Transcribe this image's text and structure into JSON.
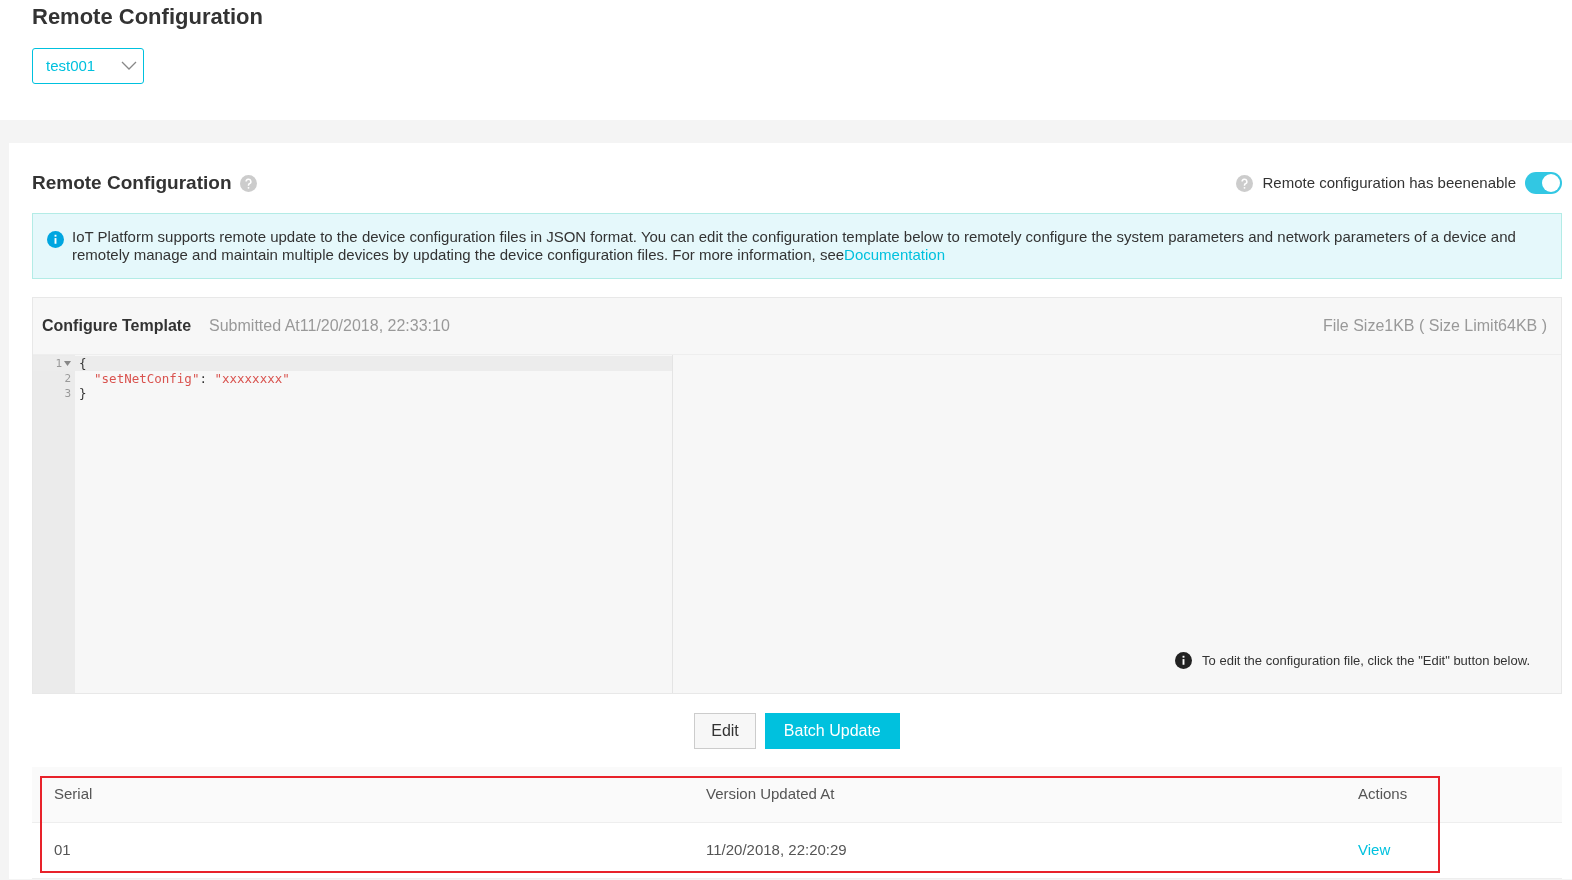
{
  "page_title": "Remote Configuration",
  "product_select": {
    "value": "test001"
  },
  "section": {
    "title": "Remote Configuration",
    "status_text": "Remote configuration has beenenable",
    "enabled": true
  },
  "notice": {
    "text": "IoT Platform supports remote update to the device configuration files in JSON format. You can edit the configuration template below to remotely configure the system parameters and network parameters of a device and remotely manage and maintain multiple devices by updating the device configuration files. For more information, see",
    "link": "Documentation"
  },
  "template": {
    "title": "Configure Template",
    "submitted": "Submitted At11/20/2018, 22:33:10",
    "file_size": "File Size1KB ( Size Limit64KB )",
    "code_lines": [
      {
        "number": "1",
        "foldable": true,
        "parts": [
          {
            "kind": "punct",
            "text": "{"
          }
        ]
      },
      {
        "number": "2",
        "foldable": false,
        "parts": [
          {
            "kind": "string",
            "text": "  \"setNetConfig\""
          },
          {
            "kind": "punct",
            "text": ": "
          },
          {
            "kind": "string",
            "text": "\"xxxxxxxx\""
          }
        ]
      },
      {
        "number": "3",
        "foldable": false,
        "parts": [
          {
            "kind": "punct",
            "text": "}"
          }
        ]
      }
    ],
    "hint": "To edit the configuration file, click the \"Edit\" button below."
  },
  "buttons": [
    {
      "label": "Edit",
      "kind": "default"
    },
    {
      "label": "Batch Update",
      "kind": "primary"
    }
  ],
  "table": {
    "highlighted": true,
    "columns": [
      "Serial",
      "Version Updated At",
      "Actions"
    ],
    "rows": [
      {
        "serial": "01",
        "updated": "11/20/2018, 22:20:29",
        "action": "View"
      }
    ]
  }
}
